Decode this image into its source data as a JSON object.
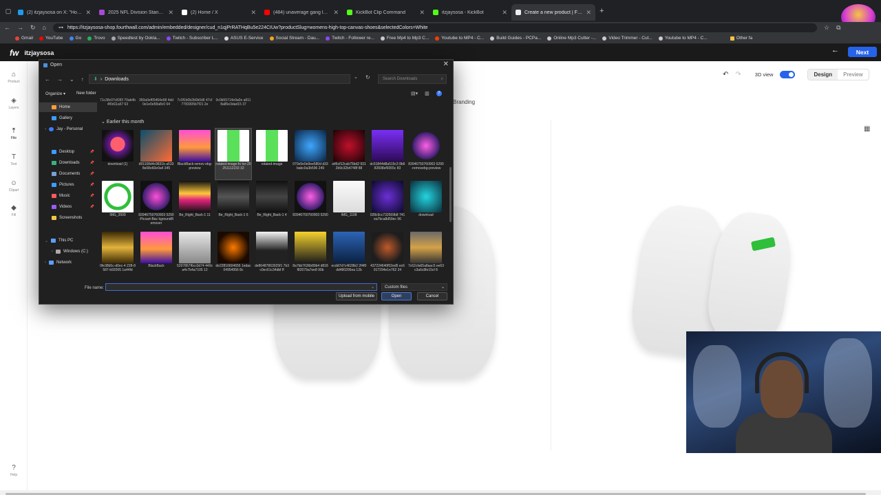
{
  "browser": {
    "tabs": [
      {
        "title": "(2) itzjaysosa on X: \"Hot topics fr",
        "active": false,
        "color": "#1d9bf0"
      },
      {
        "title": "2025 NFL Division Standings",
        "active": false,
        "color": "#a64ad6"
      },
      {
        "title": "(2) Home / X",
        "active": false,
        "color": "#ffffff"
      },
      {
        "title": "(484) unaverage gang laid to wa",
        "active": false,
        "color": "#ff0000"
      },
      {
        "title": "KickBot Clip Command",
        "active": false,
        "color": "#53fc18"
      },
      {
        "title": "itzjaysosa - KickBot",
        "active": false,
        "color": "#53fc18"
      },
      {
        "title": "Create a new product | Fourthwall",
        "active": true,
        "color": "#eeeeee"
      }
    ],
    "url": "https://itzjaysosa-shop.fourthwall.com/admin/embedded/designer/cud_n1qjPrRATHqBu5e224CIUw?productSlug=womens-high-top-canvas-shoes&selectedColors=White",
    "bookmarks": [
      "Gmail",
      "YouTube",
      "Go",
      "Trovo",
      "Speedtest by Ookla...",
      "Twitch - Subscriber L...",
      "ASUS E-Service",
      "Social Stream - Dau...",
      "Twitch - Follower re...",
      "Free Mp4 to Mp3 C...",
      "Youtube to MP4 - C...",
      "Build Guides - PCPa...",
      "Online Mp3 Cutter -...",
      "Video Trimmer - Cut...",
      "Youtube to MP4 - C..."
    ],
    "other_bookmarks": "Other fa"
  },
  "app": {
    "logo": "fw",
    "store_name": "itzjaysosa",
    "next_label": "Next",
    "rail": [
      {
        "label": "Product",
        "icon": "product-icon"
      },
      {
        "label": "Layers",
        "icon": "layers-icon"
      },
      {
        "label": "File",
        "icon": "upload-icon"
      },
      {
        "label": "Text",
        "icon": "text-icon"
      },
      {
        "label": "Clipart",
        "icon": "clipart-icon"
      },
      {
        "label": "Fill",
        "icon": "fill-icon"
      },
      {
        "label": "Help",
        "icon": "help-icon"
      }
    ],
    "view_3d_label": "3D view",
    "design_label": "Design",
    "preview_label": "Preview",
    "branding_label": "Branding"
  },
  "dialog": {
    "title": "Open",
    "path": "Downloads",
    "search_placeholder": "Search Downloads",
    "organize_label": "Organize",
    "new_folder_label": "New folder",
    "nav": [
      {
        "label": "Home",
        "selected": true,
        "color": "#ff9d3b"
      },
      {
        "label": "Gallery",
        "selected": false,
        "color": "#3b9dff"
      },
      {
        "label": "Jay - Personal",
        "selected": false,
        "color": "#3b7dff"
      },
      {
        "label": "Desktop",
        "selected": false,
        "color": "#3b9dff"
      },
      {
        "label": "Downloads",
        "selected": false,
        "color": "#36b37e"
      },
      {
        "label": "Documents",
        "selected": false,
        "color": "#7a9fd6"
      },
      {
        "label": "Pictures",
        "selected": false,
        "color": "#3b9dff"
      },
      {
        "label": "Music",
        "selected": false,
        "color": "#ff5a5f"
      },
      {
        "label": "Videos",
        "selected": false,
        "color": "#9b59ff"
      },
      {
        "label": "Screenshots",
        "selected": false,
        "color": "#f5c542"
      },
      {
        "label": "This PC",
        "selected": false,
        "color": "#5aa0ff"
      },
      {
        "label": "Windows (C:)",
        "selected": false,
        "color": "#aaaaaa"
      },
      {
        "label": "Network",
        "selected": false,
        "color": "#5aa0ff"
      }
    ],
    "top_row_names": [
      "71c38c07c83f3 70ab4b4f0d11a57 63",
      "350a0ef65464e68 4dd0e1e0e58a8c0 04",
      "7c0f1b0b2b0b0d6 47cf7783305b7f21 2e",
      "0c0b55714e9a0e a8118a85e3dad15 37"
    ],
    "group_label": "Earlier this month",
    "files": [
      [
        "download (1)",
        "d91108d4c9831b a5338e08e60e0a4 345",
        "BlackBack-remov ebg-preview",
        "rotated-image-fo tor-20251112233 32",
        "rotated-image",
        "070e5e0e9ee580d d33babc0a3b596 249",
        "a46cf12cab75bd2 9312b9c32b4748f 88",
        "dc51844d8a515c3 8b682838ef9355c 83",
        "83946750760903 5290-removebg-preview"
      ],
      [
        "IMG_3509",
        "83946750760903 5290-Picsart-Bac kgroundRemover",
        "Be_Right_Back-1 11",
        "Be_Right_Back-1 5",
        "Be_Right_Back-1 4",
        "83946750760903 5290",
        "IMG_1198",
        "028c9cc732569b8 741ea7bca8d59ec 96",
        "download"
      ],
      [
        "0fe38b5c-d0ec-4 228-8587-b92005 1a44fd",
        "BlackBack",
        "5297867f6cc0d74 440ca4c7b4a7105 12",
        "de22816604656 1edac04954956 8c",
        "de86487863025f1 7b3c0ec61c34dbf ff",
        "8a7bb7636b89b4 d818f82079a7ee8 90b",
        "ecdd7d7c4628b2 2f4f0dd480206ea 12b",
        "437224640f02ed5 ec6917294e1e762 24",
        "7c62cfa65a8aac5 ee63c3a6c8fe15cf 8"
      ]
    ],
    "file_name_label": "File name:",
    "file_name_value": "",
    "file_type": "Custom files",
    "upload_mobile_label": "Upload from mobile",
    "open_label": "Open",
    "cancel_label": "Cancel"
  }
}
